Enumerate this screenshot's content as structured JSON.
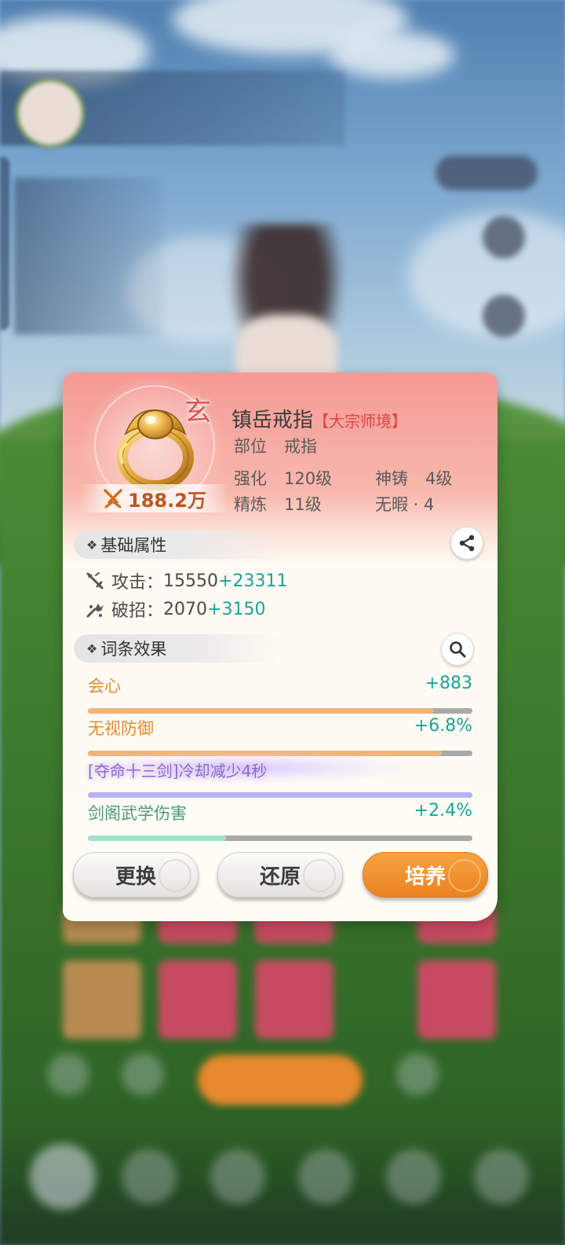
{
  "item": {
    "tier_badge": "玄",
    "power": "188.2万",
    "name": "镇岳戒指",
    "realm": "【大宗师境】",
    "slot_label": "部位",
    "slot_value": "戒指",
    "enhance_label": "强化",
    "enhance_value": "120级",
    "forge_label": "神铸",
    "forge_value": "4级",
    "refine_label": "精炼",
    "refine_value": "11级",
    "flawless": "无暇 · 4"
  },
  "base_section": {
    "title": "基础属性",
    "share_icon": "share-icon",
    "stats": [
      {
        "icon": "attack-icon",
        "label": "攻击：",
        "base": "15550",
        "bonus": "+23311"
      },
      {
        "icon": "break-icon",
        "label": "破招：",
        "base": "2070",
        "bonus": "+3150"
      }
    ]
  },
  "affix_section": {
    "title": "词条效果",
    "search_icon": "search-icon",
    "affixes": [
      {
        "name": "会心",
        "value": "+883",
        "name_color": "#e68a2e",
        "bar_color": "#f2b47a",
        "fill": 0.9
      },
      {
        "name": "无视防御",
        "value": "+6.8%",
        "name_color": "#e68a2e",
        "bar_color": "#f2b47a",
        "fill": 0.92
      },
      {
        "name": "[夺命十三剑]冷却减少4秒",
        "value": "",
        "name_color": "#8a6ad0",
        "bar_color": "#b7b3f2",
        "fill": 1.0
      },
      {
        "name": "剑阁武学伤害",
        "value": "+2.4%",
        "name_color": "#4a9a7a",
        "bar_color": "#9fe3cc",
        "fill": 0.36
      }
    ]
  },
  "buttons": {
    "replace": "更换",
    "restore": "还原",
    "cultivate": "培养"
  },
  "colors": {
    "accent_orange": "#ea8221",
    "bonus_teal": "#1aa39a",
    "realm_red": "#e0433f"
  }
}
